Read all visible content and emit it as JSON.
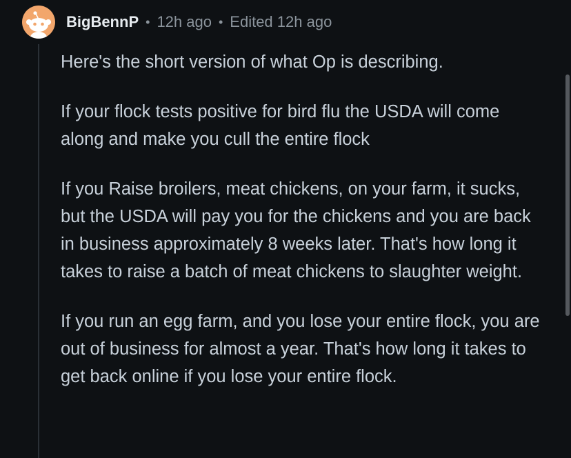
{
  "comment": {
    "username": "BigBennP",
    "time": "12h ago",
    "edited": "Edited 12h ago",
    "separator": "•",
    "paragraphs": [
      "Here's the short version of what Op is describing.",
      "If your flock tests positive for bird flu the USDA will come along and make you cull the entire flock",
      "If you Raise broilers, meat chickens, on your farm, it sucks, but the USDA will pay you for the chickens and you are back in business approximately 8 weeks later. That's how long it takes to raise a batch of meat chickens to slaughter weight.",
      "If you run an egg farm, and you lose your entire flock, you are out of business for almost a year. That's how long it takes to get back online if you lose your entire flock."
    ]
  },
  "colors": {
    "background": "#0e1114",
    "avatar": "#f2a66c",
    "text": "#c8d1da",
    "meta": "#8b949c"
  },
  "icons": {
    "avatar": "reddit-snoo-avatar-icon"
  }
}
